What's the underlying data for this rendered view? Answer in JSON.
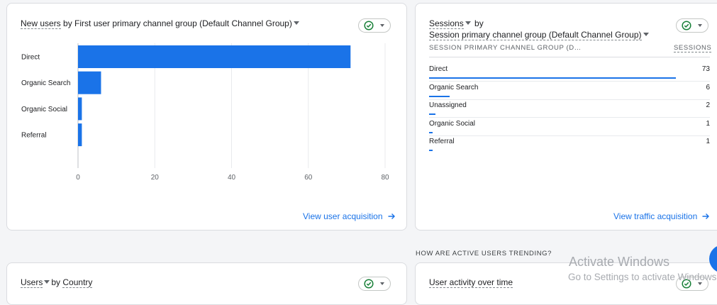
{
  "card_new_users": {
    "title_metric": "New users",
    "title_rest": "by First user primary channel group (Default Channel Group)",
    "link": "View user acquisition",
    "chart_data": {
      "type": "bar",
      "orientation": "horizontal",
      "categories": [
        "Direct",
        "Organic Search",
        "Organic Social",
        "Referral"
      ],
      "values": [
        71,
        6,
        1,
        1
      ],
      "xlim": [
        0,
        80
      ],
      "x_ticks": [
        "0",
        "20",
        "40",
        "60",
        "80"
      ],
      "grid": true,
      "color": "#1a73e8"
    }
  },
  "card_sessions": {
    "title_metric": "Sessions",
    "title_by": "by",
    "title_dimension": "Session primary channel group (Default Channel Group)",
    "col_dimension": "SESSION PRIMARY CHANNEL GROUP (D…",
    "col_metric": "SESSIONS",
    "rows": [
      {
        "label": "Direct",
        "value": "73",
        "fraction": 1.0
      },
      {
        "label": "Organic Search",
        "value": "6",
        "fraction": 0.082
      },
      {
        "label": "Unassigned",
        "value": "2",
        "fraction": 0.027
      },
      {
        "label": "Organic Social",
        "value": "1",
        "fraction": 0.014
      },
      {
        "label": "Referral",
        "value": "1",
        "fraction": 0.014
      }
    ],
    "link": "View traffic acquisition"
  },
  "section_heading": "HOW ARE ACTIVE USERS TRENDING?",
  "card_users_country": {
    "title_metric": "Users",
    "title_by": "by",
    "title_dimension": "Country"
  },
  "card_user_activity": {
    "title": "User activity over time"
  },
  "watermark": {
    "title": "Activate Windows",
    "subtitle": "Go to Settings to activate Windows."
  },
  "icons": {
    "status": "check-circle-icon",
    "dropdown": "caret-down-icon",
    "link_arrow": "arrow-right-icon"
  },
  "colors": {
    "accent": "#1a73e8",
    "check_green": "#188038"
  }
}
